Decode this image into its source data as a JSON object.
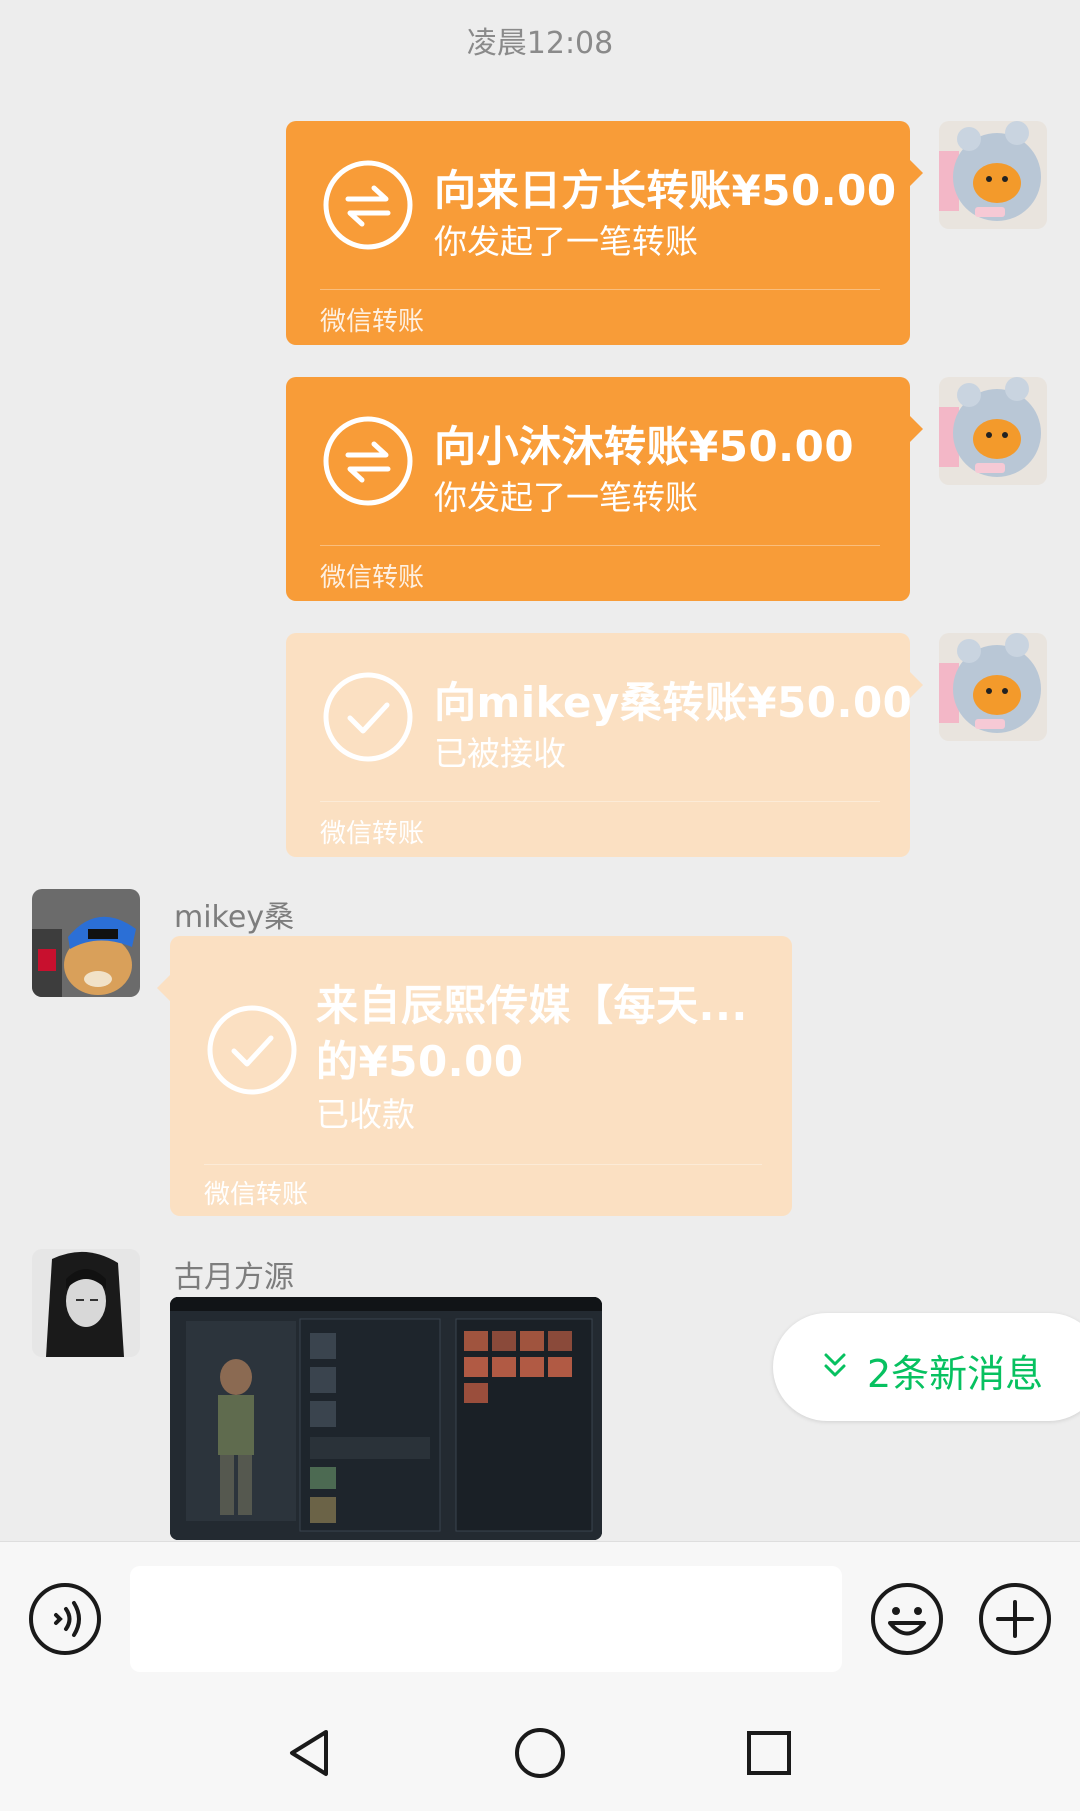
{
  "timestamp": "凌晨12:08",
  "messages": [
    {
      "type": "transfer",
      "direction": "outgoing",
      "state": "pending",
      "title": "向来日方长转账¥50.00",
      "subtitle": "你发起了一笔转账",
      "footer": "微信转账"
    },
    {
      "type": "transfer",
      "direction": "outgoing",
      "state": "pending",
      "title": "向小沐沐转账¥50.00",
      "subtitle": "你发起了一笔转账",
      "footer": "微信转账"
    },
    {
      "type": "transfer",
      "direction": "outgoing",
      "state": "accepted",
      "title": "向mikey桑转账¥50.00",
      "subtitle": "已被接收",
      "footer": "微信转账"
    },
    {
      "type": "transfer",
      "direction": "incoming",
      "state": "received",
      "sender": "mikey桑",
      "title_line1": "来自辰熙传媒【每天...",
      "title_line2": "的¥50.00",
      "subtitle": "已收款",
      "footer": "微信转账"
    },
    {
      "type": "image",
      "direction": "incoming",
      "sender": "古月方源"
    }
  ],
  "new_messages_badge": "2条新消息",
  "colors": {
    "transfer_orange": "#f89c38",
    "transfer_pale": "#fbe0c2",
    "wechat_green": "#07c160",
    "background": "#ededed"
  },
  "icons": {
    "voice": "voice-input-icon",
    "emoji": "emoji-icon",
    "more": "plus-circle-icon",
    "back": "nav-back-icon",
    "home": "nav-home-icon",
    "recents": "nav-recents-icon"
  }
}
